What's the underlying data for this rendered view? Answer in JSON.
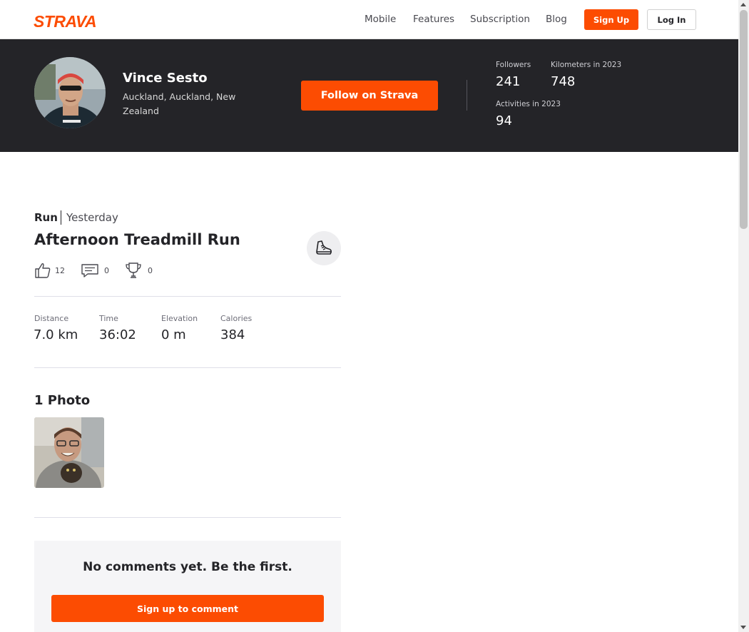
{
  "nav": {
    "logo": "STRAVA",
    "links": [
      "Mobile",
      "Features",
      "Subscription",
      "Blog"
    ],
    "signup_label": "Sign Up",
    "login_label": "Log In"
  },
  "athlete": {
    "name": "Vince Sesto",
    "location": "Auckland, Auckland, New Zealand",
    "follow_label": "Follow on Strava",
    "stats": [
      {
        "label": "Followers",
        "value": "241"
      },
      {
        "label": "Kilometers in 2023",
        "value": "748"
      },
      {
        "label": "Activities in 2023",
        "value": "94"
      }
    ]
  },
  "activity": {
    "type": "Run",
    "date": "Yesterday",
    "title": "Afternoon Treadmill Run",
    "icon": "shoe-icon",
    "kudos": "12",
    "comments": "0",
    "achievements": "0",
    "metrics": [
      {
        "label": "Distance",
        "value": "7.0 km"
      },
      {
        "label": "Time",
        "value": "36:02"
      },
      {
        "label": "Elevation",
        "value": "0 m"
      },
      {
        "label": "Calories",
        "value": "384"
      }
    ]
  },
  "photos": {
    "title": "1 Photo"
  },
  "comments": {
    "empty_text": "No comments yet. Be the first.",
    "cta_label": "Sign up to comment"
  },
  "colors": {
    "brand": "#fc4c02",
    "banner": "#242428"
  }
}
